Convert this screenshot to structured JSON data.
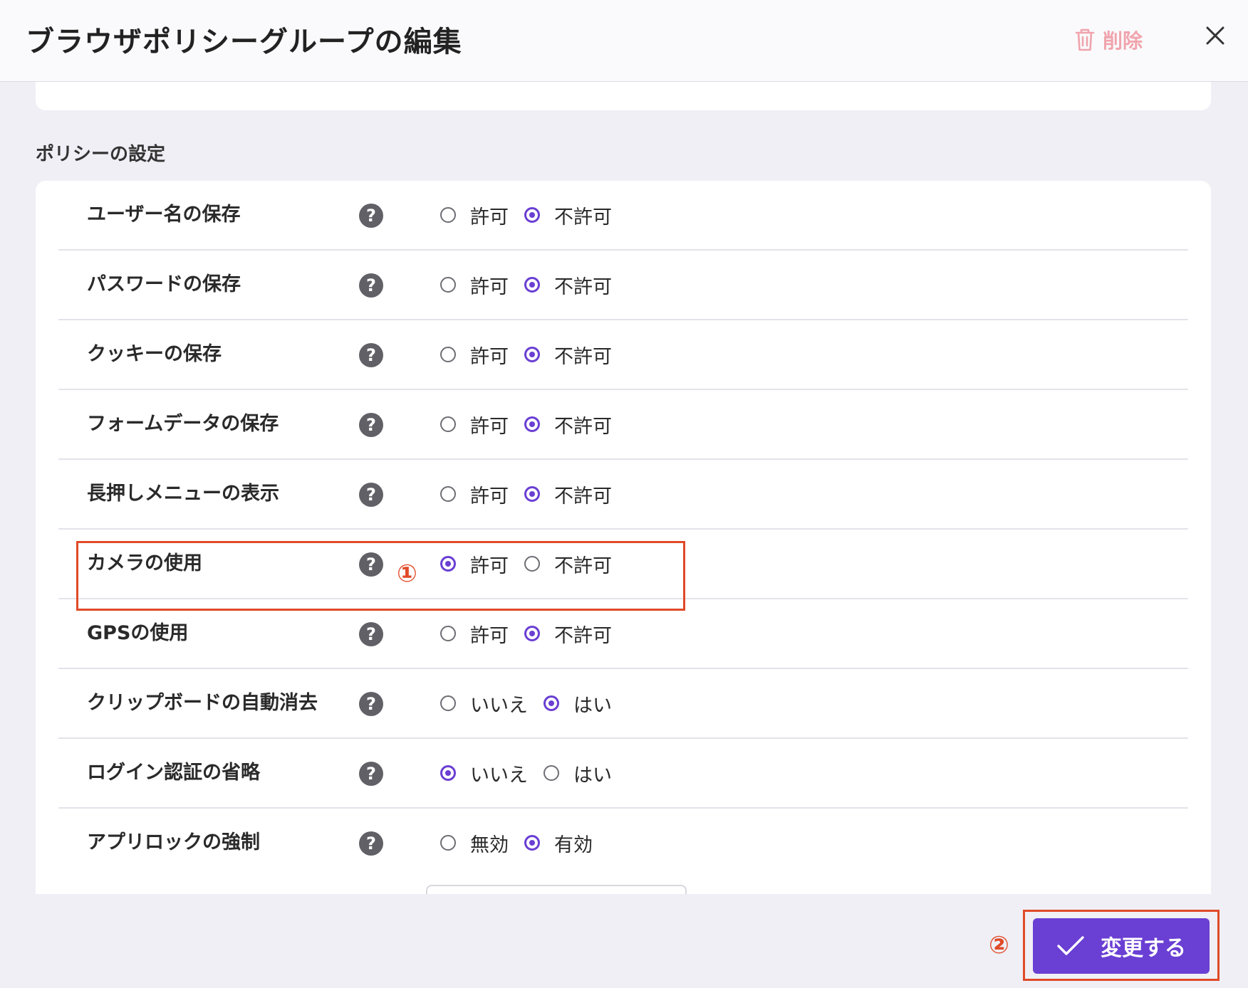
{
  "header": {
    "title": "ブラウザポリシーグループの編集",
    "delete_label": "削除"
  },
  "section": {
    "title": "ポリシーの設定"
  },
  "help_glyph": "?",
  "policies": [
    {
      "label": "ユーザー名の保存",
      "options": [
        "許可",
        "不許可"
      ],
      "selected": 1
    },
    {
      "label": "パスワードの保存",
      "options": [
        "許可",
        "不許可"
      ],
      "selected": 1
    },
    {
      "label": "クッキーの保存",
      "options": [
        "許可",
        "不許可"
      ],
      "selected": 1
    },
    {
      "label": "フォームデータの保存",
      "options": [
        "許可",
        "不許可"
      ],
      "selected": 1
    },
    {
      "label": "長押しメニューの表示",
      "options": [
        "許可",
        "不許可"
      ],
      "selected": 1
    },
    {
      "label": "カメラの使用",
      "options": [
        "許可",
        "不許可"
      ],
      "selected": 0
    },
    {
      "label": "GPSの使用",
      "options": [
        "許可",
        "不許可"
      ],
      "selected": 1
    },
    {
      "label": "クリップボードの自動消去",
      "options": [
        "いいえ",
        "はい"
      ],
      "selected": 1
    },
    {
      "label": "ログイン認証の省略",
      "options": [
        "いいえ",
        "はい"
      ],
      "selected": 0
    },
    {
      "label": "アプリロックの強制",
      "options": [
        "無効",
        "有効"
      ],
      "selected": 1
    }
  ],
  "annotations": {
    "step1": "①",
    "step2": "②"
  },
  "footer": {
    "submit_label": "変更する"
  },
  "colors": {
    "accent": "#6a3fd3",
    "annotation": "#e04a28",
    "delete": "#f0a4ad"
  }
}
